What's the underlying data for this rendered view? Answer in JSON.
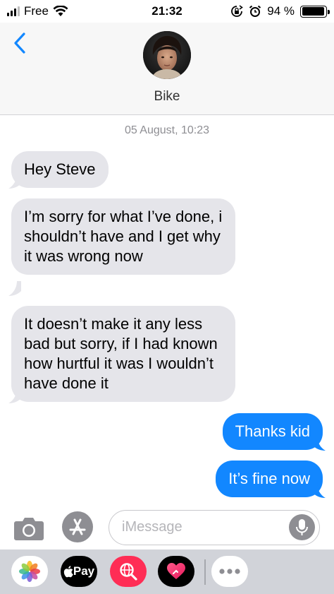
{
  "status_bar": {
    "carrier": "Free",
    "time": "21:32",
    "battery_percent": "94 %",
    "battery_level": 0.94,
    "icons": [
      "signal-bars-icon",
      "wifi-icon",
      "orientation-lock-icon",
      "alarm-icon",
      "battery-icon"
    ]
  },
  "header": {
    "contact_name": "Bike",
    "back_icon": "chevron-left-icon",
    "accent": "#1287ff"
  },
  "conversation": {
    "timestamp": "05 August, 10:23",
    "messages": [
      {
        "direction": "incoming",
        "text": "Hey Steve"
      },
      {
        "direction": "incoming",
        "text": "I’m sorry for what I’ve done, i shouldn’t have and I get why it was wrong now"
      },
      {
        "direction": "incoming",
        "text": "It doesn’t make it any less bad but sorry, if I had known how hurtful it was I wouldn’t have done it"
      },
      {
        "direction": "outgoing",
        "text": "Thanks kid"
      },
      {
        "direction": "outgoing",
        "text": "It’s fine now"
      }
    ],
    "colors": {
      "incoming": "#e5e5ea",
      "outgoing": "#1287ff"
    }
  },
  "composer": {
    "placeholder": "iMessage",
    "icons": [
      "camera-icon",
      "app-store-icon",
      "microphone-icon"
    ]
  },
  "app_drawer": {
    "apps": [
      "photos-app-icon",
      "apple-pay-app-icon",
      "web-images-app-icon",
      "digital-touch-app-icon",
      "more-apps-icon"
    ],
    "pay_label": "Pay"
  }
}
